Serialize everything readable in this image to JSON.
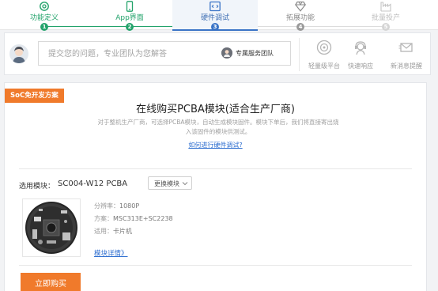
{
  "stepper": {
    "steps": [
      {
        "label": "功能定义",
        "number": "1",
        "status": "done",
        "icon": "settings-icon"
      },
      {
        "label": "App界面",
        "number": "2",
        "status": "done",
        "icon": "phone-icon"
      },
      {
        "label": "硬件调试",
        "number": "3",
        "status": "current",
        "icon": "code-icon"
      },
      {
        "label": "拓展功能",
        "number": "4",
        "status": "pending",
        "icon": "diamond-icon"
      },
      {
        "label": "批量投产",
        "number": "5",
        "status": "disabled",
        "icon": "factory-icon"
      }
    ],
    "colors": {
      "done": "#23a36b",
      "current": "#3a74c6",
      "pending": "#9a9a9a"
    }
  },
  "consult": {
    "placeholder": "提交您的问题，专业团队为您解答",
    "team_label": "专属服务团队",
    "services": [
      {
        "label": "轻量级平台",
        "icon": "target-icon"
      },
      {
        "label": "快速响应",
        "icon": "support-icon"
      },
      {
        "label": "新消息提醒",
        "icon": "message-icon"
      }
    ]
  },
  "product": {
    "tag": "SoC免开发方案",
    "title": "在线购买PCBA模块(适合生产厂商)",
    "description_lines": [
      "对于整机生产厂商，可选择PCBA模块，自动生成模块固件。模块下单后，我们将直接寄出烧",
      "入该固件的模块供测试。"
    ],
    "howto_link": "如何进行硬件调试?",
    "select_label": "选用模块：",
    "selected_module": "SC004-W12 PCBA",
    "swap_button": "更换模块",
    "specs": [
      {
        "key": "分辨率：",
        "value": "1080P"
      },
      {
        "key": "方案：",
        "value": "MSC313E+SC2238"
      },
      {
        "key": "适用：",
        "value": "卡片机"
      }
    ],
    "details_link": "模块详情》",
    "buy_button": "立即购买",
    "accent_color": "#f07a2b",
    "link_color": "#2f6fd0"
  }
}
